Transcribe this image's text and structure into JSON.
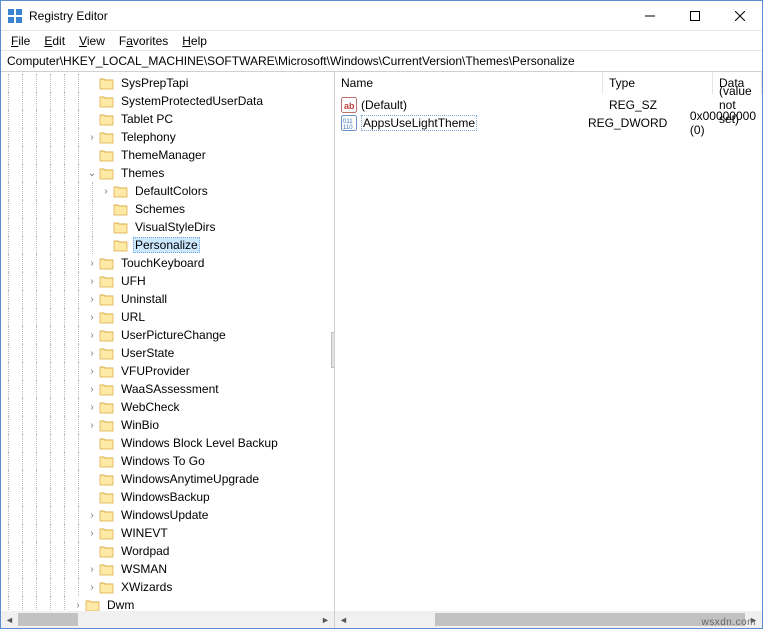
{
  "window": {
    "title": "Registry Editor"
  },
  "menubar": {
    "file": "File",
    "edit": "Edit",
    "view": "View",
    "favorites": "Favorites",
    "help": "Help"
  },
  "address": "Computer\\HKEY_LOCAL_MACHINE\\SOFTWARE\\Microsoft\\Windows\\CurrentVersion\\Themes\\Personalize",
  "columns": {
    "name": "Name",
    "type": "Type",
    "data": "Data"
  },
  "values": [
    {
      "icon": "string",
      "name": "(Default)",
      "type": "REG_SZ",
      "data": "(value not set)",
      "selected": false
    },
    {
      "icon": "dword",
      "name": "AppsUseLightTheme",
      "type": "REG_DWORD",
      "data": "0x00000000 (0)",
      "selected": true
    }
  ],
  "tree": [
    {
      "indent": 6,
      "tw": "",
      "label": "SysPrepTapi",
      "sel": false
    },
    {
      "indent": 6,
      "tw": "",
      "label": "SystemProtectedUserData",
      "sel": false
    },
    {
      "indent": 6,
      "tw": "",
      "label": "Tablet PC",
      "sel": false
    },
    {
      "indent": 6,
      "tw": ">",
      "label": "Telephony",
      "sel": false
    },
    {
      "indent": 6,
      "tw": "",
      "label": "ThemeManager",
      "sel": false
    },
    {
      "indent": 6,
      "tw": "v",
      "label": "Themes",
      "sel": false
    },
    {
      "indent": 7,
      "tw": ">",
      "label": "DefaultColors",
      "sel": false
    },
    {
      "indent": 7,
      "tw": "",
      "label": "Schemes",
      "sel": false
    },
    {
      "indent": 7,
      "tw": "",
      "label": "VisualStyleDirs",
      "sel": false
    },
    {
      "indent": 7,
      "tw": "",
      "label": "Personalize",
      "sel": true
    },
    {
      "indent": 6,
      "tw": ">",
      "label": "TouchKeyboard",
      "sel": false
    },
    {
      "indent": 6,
      "tw": ">",
      "label": "UFH",
      "sel": false
    },
    {
      "indent": 6,
      "tw": ">",
      "label": "Uninstall",
      "sel": false
    },
    {
      "indent": 6,
      "tw": ">",
      "label": "URL",
      "sel": false
    },
    {
      "indent": 6,
      "tw": ">",
      "label": "UserPictureChange",
      "sel": false
    },
    {
      "indent": 6,
      "tw": ">",
      "label": "UserState",
      "sel": false
    },
    {
      "indent": 6,
      "tw": ">",
      "label": "VFUProvider",
      "sel": false
    },
    {
      "indent": 6,
      "tw": ">",
      "label": "WaaSAssessment",
      "sel": false
    },
    {
      "indent": 6,
      "tw": ">",
      "label": "WebCheck",
      "sel": false
    },
    {
      "indent": 6,
      "tw": ">",
      "label": "WinBio",
      "sel": false
    },
    {
      "indent": 6,
      "tw": "",
      "label": "Windows Block Level Backup",
      "sel": false
    },
    {
      "indent": 6,
      "tw": "",
      "label": "Windows To Go",
      "sel": false
    },
    {
      "indent": 6,
      "tw": "",
      "label": "WindowsAnytimeUpgrade",
      "sel": false
    },
    {
      "indent": 6,
      "tw": "",
      "label": "WindowsBackup",
      "sel": false
    },
    {
      "indent": 6,
      "tw": ">",
      "label": "WindowsUpdate",
      "sel": false
    },
    {
      "indent": 6,
      "tw": ">",
      "label": "WINEVT",
      "sel": false
    },
    {
      "indent": 6,
      "tw": "",
      "label": "Wordpad",
      "sel": false
    },
    {
      "indent": 6,
      "tw": ">",
      "label": "WSMAN",
      "sel": false
    },
    {
      "indent": 6,
      "tw": ">",
      "label": "XWizards",
      "sel": false
    },
    {
      "indent": 5,
      "tw": ">",
      "label": "Dwm",
      "sel": false
    }
  ],
  "watermark": "wsxdn.com"
}
